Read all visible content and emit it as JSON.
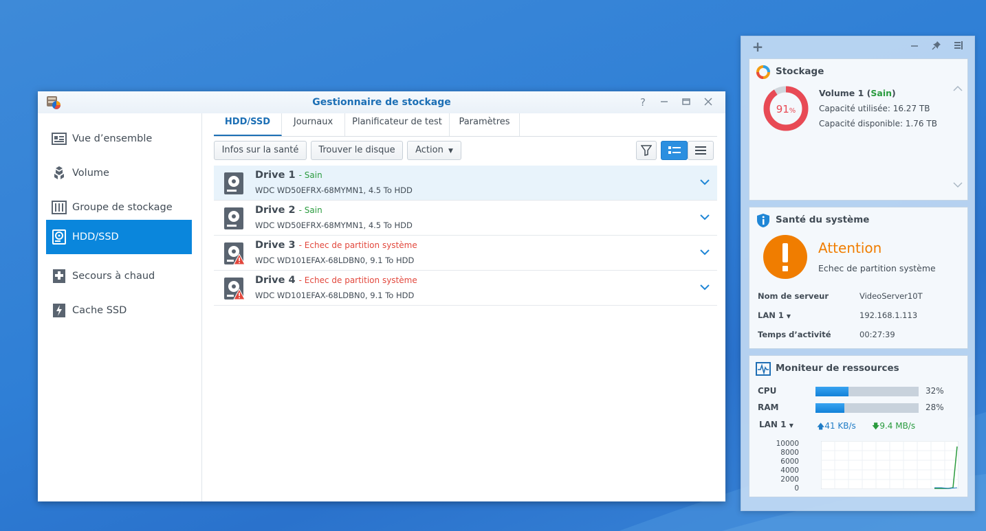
{
  "window": {
    "title": "Gestionnaire de stockage",
    "controls": {
      "help": "?",
      "minimize": "—",
      "maximize": "□",
      "close": "✕"
    }
  },
  "sidebar": {
    "items": [
      {
        "label": "Vue d’ensemble",
        "icon": "overview-icon",
        "active": false
      },
      {
        "label": "Volume",
        "icon": "volume-icon",
        "active": false
      },
      {
        "label": "Groupe de stockage",
        "icon": "storage-pool-icon",
        "active": false
      },
      {
        "label": "HDD/SSD",
        "icon": "hdd-icon",
        "active": true
      },
      {
        "label": "Secours à chaud",
        "icon": "hot-spare-icon",
        "active": false
      },
      {
        "label": "Cache SSD",
        "icon": "ssd-cache-icon",
        "active": false
      }
    ]
  },
  "tabs": [
    {
      "label": "HDD/SSD",
      "active": true
    },
    {
      "label": "Journaux",
      "active": false
    },
    {
      "label": "Planificateur de test",
      "active": false
    },
    {
      "label": "Paramètres",
      "active": false
    }
  ],
  "toolbar": {
    "health_info": "Infos sur la santé",
    "find_disk": "Trouver le disque",
    "action": "Action"
  },
  "drives": [
    {
      "name": "Drive 1",
      "status": "- Sain",
      "status_kind": "ok",
      "model": "WDC WD50EFRX-68MYMN1, 4.5 To HDD",
      "selected": true
    },
    {
      "name": "Drive 2",
      "status": "- Sain",
      "status_kind": "ok",
      "model": "WDC WD50EFRX-68MYMN1, 4.5 To HDD",
      "selected": false
    },
    {
      "name": "Drive 3",
      "status": "- Echec de partition système",
      "status_kind": "bad",
      "model": "WDC WD101EFAX-68LDBN0, 9.1 To HDD",
      "selected": false
    },
    {
      "name": "Drive 4",
      "status": "- Echec de partition système",
      "status_kind": "bad",
      "model": "WDC WD101EFAX-68LDBN0, 9.1 To HDD",
      "selected": false
    }
  ],
  "panel": {
    "controls": {
      "add": "+",
      "minimize": "—",
      "pin": "pin-icon",
      "collapse": "collapse-icon"
    }
  },
  "storage_widget": {
    "title": "Stockage",
    "percent": "91",
    "percent_unit": "%",
    "usage_fraction": 0.91,
    "volume_name": "Volume 1 (",
    "volume_state": "Sain",
    "volume_close": ")",
    "used": "Capacité utilisée: 16.27 TB",
    "free": "Capacité disponible: 1.76 TB"
  },
  "health_widget": {
    "title": "Santé du système",
    "status_title": "Attention",
    "status_text": "Echec de partition système",
    "server_label": "Nom de serveur",
    "server_value": "VideoServer10T",
    "lan_label": "LAN 1",
    "lan_value": "192.168.1.113",
    "uptime_label": "Temps d’activité",
    "uptime_value": "00:27:39"
  },
  "resource_widget": {
    "title": "Moniteur de ressources",
    "cpu_label": "CPU",
    "cpu_value": "32%",
    "cpu_fraction": 0.32,
    "ram_label": "RAM",
    "ram_value": "28%",
    "ram_fraction": 0.28,
    "lan_label": "LAN 1",
    "upload": "41 KB/s",
    "download": "9.4 MB/s",
    "chart_ticks": [
      "10000",
      "8000",
      "6000",
      "4000",
      "2000",
      "0"
    ]
  },
  "colors": {
    "accent": "#0a86dc",
    "ok": "#2a9b3e",
    "error": "#e2473c",
    "warning": "#f07d00",
    "donut": "#e84a55"
  }
}
